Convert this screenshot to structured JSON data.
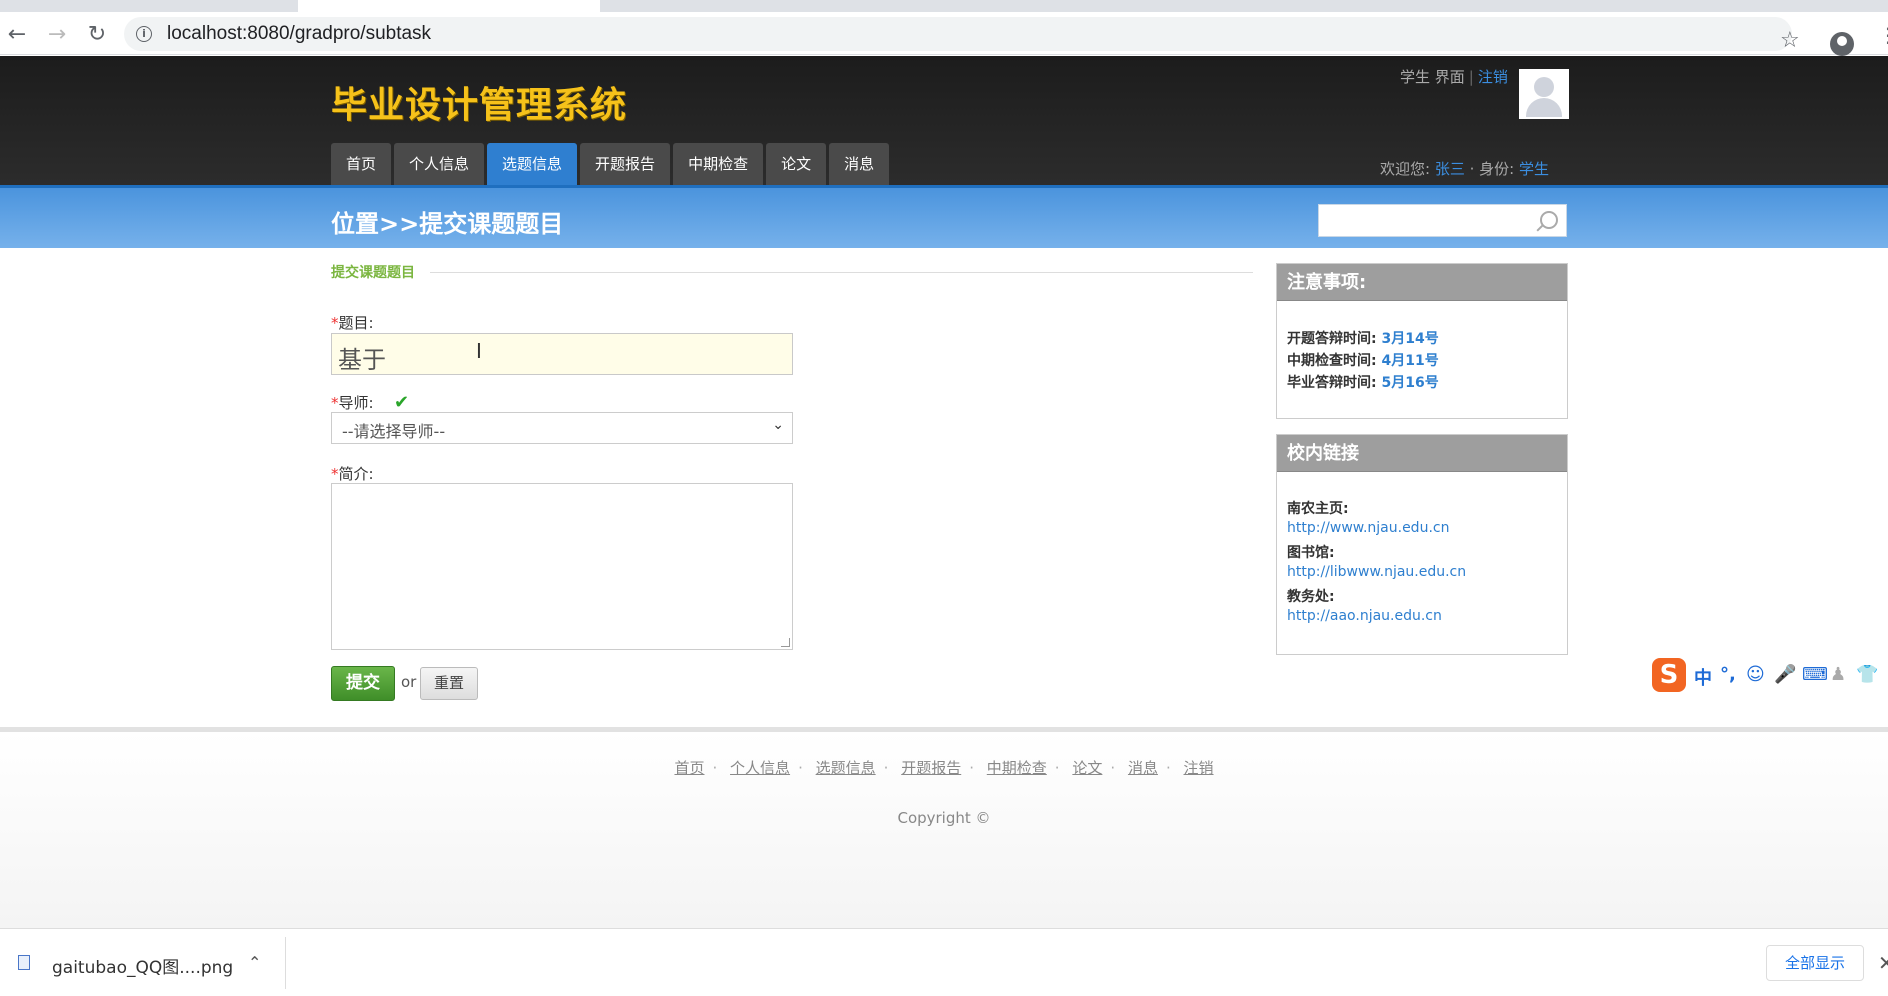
{
  "browser": {
    "url": "localhost:8080/gradpro/subtask",
    "icons": [
      "back-icon",
      "forward-icon",
      "reload-icon",
      "info-icon",
      "star-icon",
      "profile-icon",
      "menu-icon"
    ]
  },
  "header": {
    "logo": "毕业设计管理系统",
    "user_role": "学生 界面",
    "logout": "注销",
    "welcome_prefix": "欢迎您:",
    "user_name": "张三",
    "identity_label": "· 身份:",
    "identity": "学生"
  },
  "nav": {
    "items": [
      {
        "label": "首页"
      },
      {
        "label": "个人信息"
      },
      {
        "label": "选题信息"
      },
      {
        "label": "开题报告"
      },
      {
        "label": "中期检查"
      },
      {
        "label": "论文"
      },
      {
        "label": "消息"
      }
    ],
    "active_index": 2
  },
  "band": {
    "crumb": "位置>>提交课题题目",
    "search_placeholder": ""
  },
  "form": {
    "section_title": "提交课题题目",
    "title_label": "题目:",
    "title_value": "基于",
    "advisor_label": "导师:",
    "advisor_selected": "--请选择导师--",
    "intro_label": "简介:",
    "intro_value": "",
    "required_mark": "*",
    "submit_label": "提交",
    "or_text": "or",
    "reset_label": "重置"
  },
  "notice": {
    "title": "注意事项:",
    "rows": [
      {
        "label": "开题答辩时间:",
        "value": "3月14号"
      },
      {
        "label": "中期检查时间:",
        "value": "4月11号"
      },
      {
        "label": "毕业答辩时间:",
        "value": "5月16号"
      }
    ]
  },
  "links": {
    "title": "校内链接",
    "items": [
      {
        "label": "南农主页:",
        "url": "http://www.njau.edu.cn"
      },
      {
        "label": "图书馆:",
        "url": "http://libwww.njau.edu.cn"
      },
      {
        "label": "教务处:",
        "url": "http://aao.njau.edu.cn"
      }
    ]
  },
  "footer": {
    "links": [
      "首页",
      "个人信息",
      "选题信息",
      "开题报告",
      "中期检查",
      "论文",
      "消息",
      "注销"
    ],
    "copyright": "Copyright ©"
  },
  "ime": {
    "logo": "S",
    "lang": "中"
  },
  "download_bar": {
    "file_name": "gaitubao_QQ图....png",
    "show_all": "全部显示"
  },
  "colors": {
    "logo": "#f6c21a",
    "nav_active": "#2f7fd0",
    "band": "#5ea2e4",
    "link": "#2e7fcf",
    "submit": "#4f9e34"
  }
}
